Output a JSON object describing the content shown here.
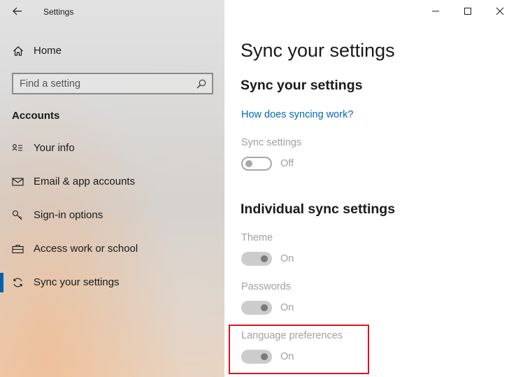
{
  "window": {
    "title": "Settings",
    "controls": {
      "minimize": "minimize",
      "maximize": "maximize",
      "close": "close"
    }
  },
  "sidebar": {
    "home_label": "Home",
    "search": {
      "placeholder": "Find a setting",
      "value": ""
    },
    "section_title": "Accounts",
    "items": [
      {
        "label": "Your info",
        "icon": "person-list-icon"
      },
      {
        "label": "Email & app accounts",
        "icon": "mail-icon"
      },
      {
        "label": "Sign-in options",
        "icon": "key-icon"
      },
      {
        "label": "Access work or school",
        "icon": "briefcase-icon"
      },
      {
        "label": "Sync your settings",
        "icon": "sync-icon",
        "active": true
      }
    ]
  },
  "main": {
    "page_title": "Sync your settings",
    "sync_heading": "Sync your settings",
    "help_link": "How does syncing work?",
    "sync_settings": {
      "label": "Sync settings",
      "state": "Off"
    },
    "individual_heading": "Individual sync settings",
    "individual": [
      {
        "label": "Theme",
        "state": "On"
      },
      {
        "label": "Passwords",
        "state": "On"
      },
      {
        "label": "Language preferences",
        "state": "On"
      }
    ]
  },
  "colors": {
    "accent": "#0063b1",
    "link": "#0067b8",
    "highlight": "#e2131e",
    "disabled_text": "#a0a0a0"
  }
}
